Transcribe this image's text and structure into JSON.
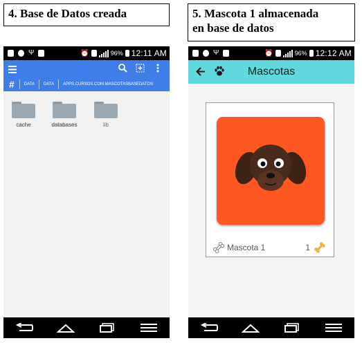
{
  "left_caption": "4. Base de Datos creada",
  "right_caption_line1": "5. Mascota 1 almacenada",
  "right_caption_line2": "en base de datos",
  "left_phone": {
    "status": {
      "battery": "96%",
      "time": "12:11 AM"
    },
    "path": [
      "DATA",
      "DATA",
      "APPS.CURSOS.COM.MASCOTASBASEDATOS"
    ],
    "folders": [
      "cache",
      "databases",
      "lib"
    ]
  },
  "right_phone": {
    "status": {
      "battery": "96%",
      "time": "12:12 AM"
    },
    "title": "Mascotas",
    "pet": {
      "name": "Mascota 1",
      "likes": "1"
    }
  },
  "colors": {
    "file_manager_bar": "#3f7de8",
    "app_bar": "#5fd8de",
    "pet_photo": "#ff5722"
  }
}
